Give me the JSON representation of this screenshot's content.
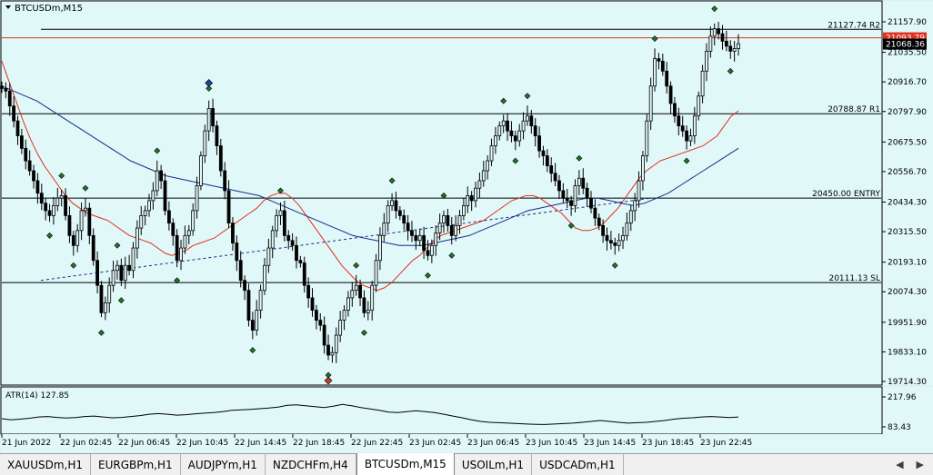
{
  "window": {
    "title": "BTCUSDm,M15"
  },
  "chart_data": [
    {
      "type": "candlestick",
      "symbol": "BTCUSDm",
      "timeframe": "M15",
      "y_ticks": [
        21157.9,
        21035.5,
        20916.7,
        20797.9,
        20675.5,
        20556.7,
        20434.3,
        20315.5,
        20193.1,
        20074.3,
        19951.9,
        19833.1,
        19714.3
      ],
      "ylim": [
        19714.3,
        21157.9
      ],
      "x_tick_labels": [
        "21 Jun 2022",
        "22 Jun 02:45",
        "22 Jun 06:45",
        "22 Jun 10:45",
        "22 Jun 14:45",
        "22 Jun 18:45",
        "22 Jun 22:45",
        "23 Jun 02:45",
        "23 Jun 06:45",
        "23 Jun 10:45",
        "23 Jun 14:45",
        "23 Jun 18:45",
        "23 Jun 22:45"
      ],
      "levels": [
        {
          "label": "21127.74 R2",
          "value": 21127.74,
          "color": "#000000"
        },
        {
          "label": "20788.87 R1",
          "value": 20788.87,
          "color": "#000000"
        },
        {
          "label": "20450.00 ENTRY",
          "value": 20450.0,
          "color": "#000000"
        },
        {
          "label": "20111.13 SL",
          "value": 20111.13,
          "color": "#000000"
        }
      ],
      "ask_price": {
        "label": "21093.79",
        "value": 21093.79,
        "color": "#e03020"
      },
      "bid_price": {
        "label": "21068.36",
        "value": 21068.36,
        "color": "#000000"
      },
      "price_series": [
        20890,
        20880,
        20820,
        20760,
        20700,
        20650,
        20600,
        20560,
        20520,
        20470,
        20430,
        20400,
        20380,
        20420,
        20450,
        20460,
        20380,
        20300,
        20260,
        20320,
        20400,
        20410,
        20300,
        20200,
        20100,
        19990,
        20030,
        20100,
        20160,
        20180,
        20120,
        20180,
        20160,
        20250,
        20330,
        20380,
        20400,
        20440,
        20480,
        20560,
        20520,
        20400,
        20350,
        20300,
        20200,
        20250,
        20300,
        20320,
        20400,
        20500,
        20620,
        20720,
        20810,
        20740,
        20660,
        20560,
        20480,
        20350,
        20270,
        20200,
        20120,
        20080,
        19960,
        19920,
        20000,
        20080,
        20180,
        20250,
        20320,
        20380,
        20400,
        20300,
        20280,
        20260,
        20200,
        20190,
        20100,
        20050,
        20000,
        19960,
        19940,
        19860,
        19820,
        19830,
        19900,
        19960,
        20000,
        20050,
        20080,
        20100,
        20050,
        19990,
        20000,
        20100,
        20200,
        20300,
        20350,
        20420,
        20440,
        20400,
        20380,
        20350,
        20320,
        20300,
        20280,
        20300,
        20240,
        20220,
        20260,
        20310,
        20350,
        20380,
        20340,
        20300,
        20340,
        20380,
        20420,
        20460,
        20440,
        20490,
        20520,
        20560,
        20600,
        20660,
        20700,
        20740,
        20760,
        20720,
        20700,
        20680,
        20720,
        20760,
        20780,
        20740,
        20700,
        20640,
        20620,
        20580,
        20550,
        20520,
        20480,
        20450,
        20440,
        20420,
        20500,
        20530,
        20490,
        20450,
        20410,
        20370,
        20340,
        20300,
        20280,
        20270,
        20260,
        20280,
        20300,
        20350,
        20400,
        20440,
        20520,
        20620,
        20760,
        20900,
        21010,
        21000,
        20960,
        20900,
        20830,
        20780,
        20740,
        20720,
        20680,
        20700,
        20780,
        20860,
        20960,
        21040,
        21100,
        21130,
        21110,
        21080,
        21060,
        21040,
        21050,
        21070
      ],
      "indicators": [
        {
          "name": "MA (red)",
          "color": "#e03020",
          "values": [
            21000,
            20920,
            20840,
            20760,
            20690,
            20630,
            20580,
            20540,
            20500,
            20460,
            20430,
            20410,
            20390,
            20380,
            20370,
            20360,
            20340,
            20320,
            20300,
            20290,
            20280,
            20270,
            20250,
            20230,
            20220,
            20230,
            20240,
            20260,
            20270,
            20280,
            20290,
            20310,
            20330,
            20350,
            20370,
            20390,
            20410,
            20440,
            20460,
            20470,
            20470,
            20450,
            20420,
            20380,
            20340,
            20300,
            20260,
            20220,
            20180,
            20150,
            20120,
            20100,
            20090,
            20080,
            20090,
            20110,
            20140,
            20170,
            20200,
            20220,
            20250,
            20280,
            20300,
            20310,
            20320,
            20330,
            20340,
            20350,
            20360,
            20380,
            20400,
            20420,
            20440,
            20450,
            20460,
            20460,
            20450,
            20430,
            20410,
            20390,
            20360,
            20330,
            20320,
            20320,
            20330,
            20350,
            20380,
            20410,
            20450,
            20490,
            20530,
            20560,
            20580,
            20600,
            20610,
            20620,
            20630,
            20640,
            20650,
            20660,
            20680,
            20700,
            20740,
            20780,
            20800
          ],
          "xrange": [
            0,
            1
          ]
        },
        {
          "name": "MA (blue)",
          "color": "#1c2a8c",
          "values": [
            20900,
            20880,
            20860,
            20840,
            20810,
            20780,
            20750,
            20720,
            20690,
            20660,
            20630,
            20600,
            20580,
            20560,
            20540,
            20530,
            20520,
            20510,
            20500,
            20490,
            20480,
            20470,
            20460,
            20440,
            20420,
            20400,
            20380,
            20360,
            20340,
            20320,
            20300,
            20290,
            20280,
            20270,
            20260,
            20260,
            20260,
            20270,
            20280,
            20290,
            20300,
            20320,
            20340,
            20360,
            20380,
            20400,
            20410,
            20420,
            20430,
            20440,
            20450,
            20450,
            20440,
            20430,
            20420,
            20430,
            20450,
            20470,
            20500,
            20530,
            20560,
            20590,
            20620,
            20650
          ],
          "xrange": [
            0,
            1
          ]
        }
      ],
      "trendline": {
        "style": "dashed",
        "color": "#1c2a8c",
        "from": {
          "x_label": "22 Jun 2022",
          "value": 20120
        },
        "to": {
          "x_label": "23 Jun 14:45",
          "value": 20450
        }
      },
      "atr": {
        "label": "ATR(14) 127.85",
        "y_ticks": [
          217.96,
          83.43
        ],
        "ylim": [
          83.43,
          217.96
        ],
        "values": [
          120,
          115,
          118,
          122,
          128,
          130,
          126,
          123,
          125,
          130,
          132,
          128,
          124,
          126,
          130,
          134,
          140,
          143,
          140,
          136,
          138,
          142,
          145,
          148,
          152,
          158,
          160,
          162,
          165,
          168,
          172,
          180,
          182,
          178,
          174,
          170,
          176,
          184,
          178,
          170,
          164,
          158,
          150,
          148,
          152,
          156,
          152,
          148,
          140,
          132,
          124,
          115,
          108,
          104,
          102,
          100,
          98,
          96,
          95,
          94,
          96,
          98,
          100,
          104,
          108,
          112,
          108,
          104,
          100,
          102,
          104,
          108,
          112,
          118,
          122,
          124,
          128,
          130,
          128,
          125,
          127.85
        ]
      }
    }
  ],
  "tabs": [
    {
      "label": "XAUUSDm,H1"
    },
    {
      "label": "EURGBPm,H1"
    },
    {
      "label": "AUDJPYm,H1"
    },
    {
      "label": "NZDCHFm,H4"
    },
    {
      "label": "BTCUSDm,M15",
      "active": true
    },
    {
      "label": "USOILm,H1"
    },
    {
      "label": "USDCADm,H1"
    }
  ],
  "tab_nav": {
    "left_icon": "triangle-left-icon",
    "right_icon": "triangle-right-icon"
  }
}
